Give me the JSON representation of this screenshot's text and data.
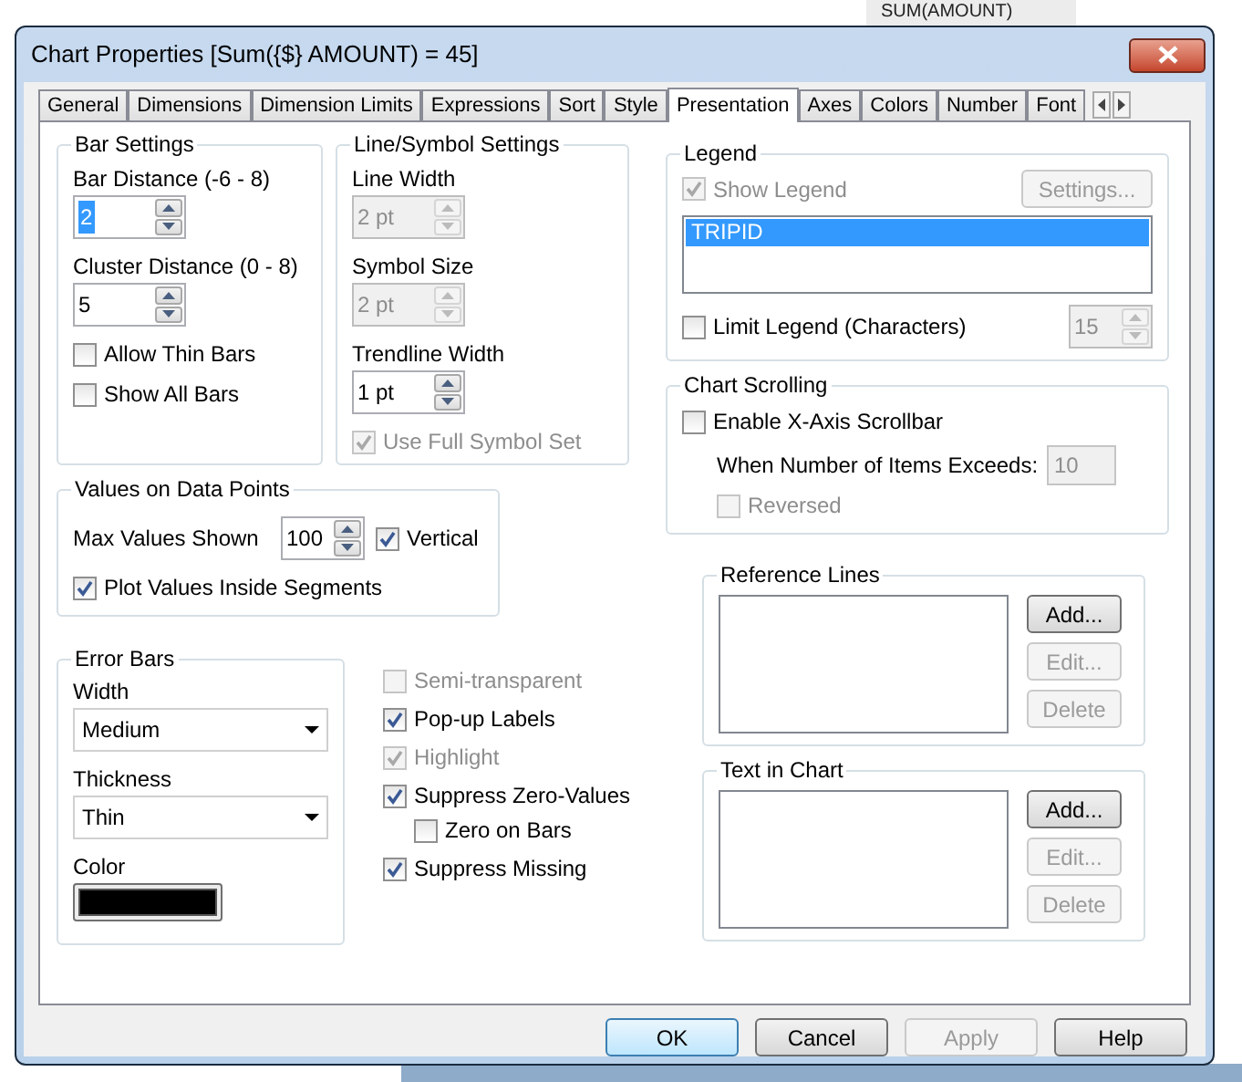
{
  "background": {
    "title": "SUM(AMOUNT)"
  },
  "window": {
    "title": "Chart Properties [Sum({$} AMOUNT) = 45]"
  },
  "tabs": [
    {
      "label": "General",
      "selected": false
    },
    {
      "label": "Dimensions",
      "selected": false
    },
    {
      "label": "Dimension Limits",
      "selected": false
    },
    {
      "label": "Expressions",
      "selected": false
    },
    {
      "label": "Sort",
      "selected": false
    },
    {
      "label": "Style",
      "selected": false
    },
    {
      "label": "Presentation",
      "selected": true
    },
    {
      "label": "Axes",
      "selected": false
    },
    {
      "label": "Colors",
      "selected": false
    },
    {
      "label": "Number",
      "selected": false
    },
    {
      "label": "Font",
      "selected": false
    }
  ],
  "bar_settings": {
    "title": "Bar Settings",
    "items": [
      {
        "kind": "spin",
        "label": "Bar Distance (-6 - 8)",
        "value": "2",
        "text_selected": true,
        "disabled": false
      },
      {
        "kind": "spin",
        "label": "Cluster Distance (0 - 8)",
        "value": "5",
        "text_selected": false,
        "disabled": false
      },
      {
        "kind": "checkbox",
        "label": "Allow Thin Bars",
        "checked": false,
        "disabled": false
      },
      {
        "kind": "checkbox",
        "label": "Show All Bars",
        "checked": false,
        "disabled": false
      }
    ]
  },
  "line_symbol_settings": {
    "title": "Line/Symbol Settings",
    "items": [
      {
        "kind": "spin",
        "label": "Line Width",
        "value": "2 pt",
        "text_selected": false,
        "disabled": true
      },
      {
        "kind": "spin",
        "label": "Symbol Size",
        "value": "2 pt",
        "text_selected": false,
        "disabled": true
      },
      {
        "kind": "spin",
        "label": "Trendline Width",
        "value": "1 pt",
        "text_selected": false,
        "disabled": false
      },
      {
        "kind": "checkbox",
        "label": "Use Full Symbol Set",
        "checked": true,
        "disabled": true
      }
    ]
  },
  "values_on_data_points": {
    "title": "Values on Data Points",
    "max_values": {
      "label": "Max Values Shown",
      "value": "100"
    },
    "vertical": {
      "label": "Vertical",
      "checked": true,
      "disabled": false
    },
    "plot_inside": {
      "label": "Plot Values Inside Segments",
      "checked": true,
      "disabled": false
    }
  },
  "error_bars": {
    "title": "Error Bars",
    "items": [
      {
        "kind": "select",
        "label": "Width",
        "value": "Medium"
      },
      {
        "kind": "select",
        "label": "Thickness",
        "value": "Thin"
      },
      {
        "kind": "color",
        "label": "Color",
        "color": "#000000"
      }
    ]
  },
  "options": [
    {
      "label": "Semi-transparent",
      "checked": false,
      "disabled": true
    },
    {
      "label": "Pop-up Labels",
      "checked": true,
      "disabled": false
    },
    {
      "label": "Highlight",
      "checked": true,
      "disabled": true
    },
    {
      "label": "Suppress Zero-Values",
      "checked": true,
      "disabled": false,
      "children": [
        {
          "label": "Zero on Bars",
          "checked": false,
          "disabled": false
        }
      ]
    },
    {
      "label": "Suppress Missing",
      "checked": true,
      "disabled": false
    }
  ],
  "legend": {
    "title": "Legend",
    "show_legend": {
      "label": "Show Legend",
      "checked": true,
      "disabled": true
    },
    "settings_button": {
      "label": "Settings...",
      "disabled": true
    },
    "items": [
      {
        "label": "TRIPID",
        "selected": true
      }
    ],
    "limit": {
      "label": "Limit Legend (Characters)",
      "checked": false,
      "disabled": false
    },
    "limit_value": {
      "value": "15",
      "disabled": true
    }
  },
  "chart_scrolling": {
    "title": "Chart Scrolling",
    "enable": {
      "label": "Enable X-Axis Scrollbar",
      "checked": false,
      "disabled": false
    },
    "threshold": {
      "label": "When Number of Items Exceeds:",
      "value": "10",
      "disabled": true
    },
    "reversed": {
      "label": "Reversed",
      "checked": false,
      "disabled": true
    }
  },
  "reference_lines": {
    "title": "Reference Lines",
    "buttons": [
      {
        "label": "Add...",
        "disabled": false
      },
      {
        "label": "Edit...",
        "disabled": true
      },
      {
        "label": "Delete",
        "disabled": true
      }
    ]
  },
  "text_in_chart": {
    "title": "Text in Chart",
    "buttons": [
      {
        "label": "Add...",
        "disabled": false
      },
      {
        "label": "Edit...",
        "disabled": true
      },
      {
        "label": "Delete",
        "disabled": true
      }
    ]
  },
  "footer_buttons": [
    {
      "label": "OK",
      "default": true,
      "disabled": false
    },
    {
      "label": "Cancel",
      "default": false,
      "disabled": false
    },
    {
      "label": "Apply",
      "default": false,
      "disabled": true
    },
    {
      "label": "Help",
      "default": false,
      "disabled": false
    }
  ]
}
